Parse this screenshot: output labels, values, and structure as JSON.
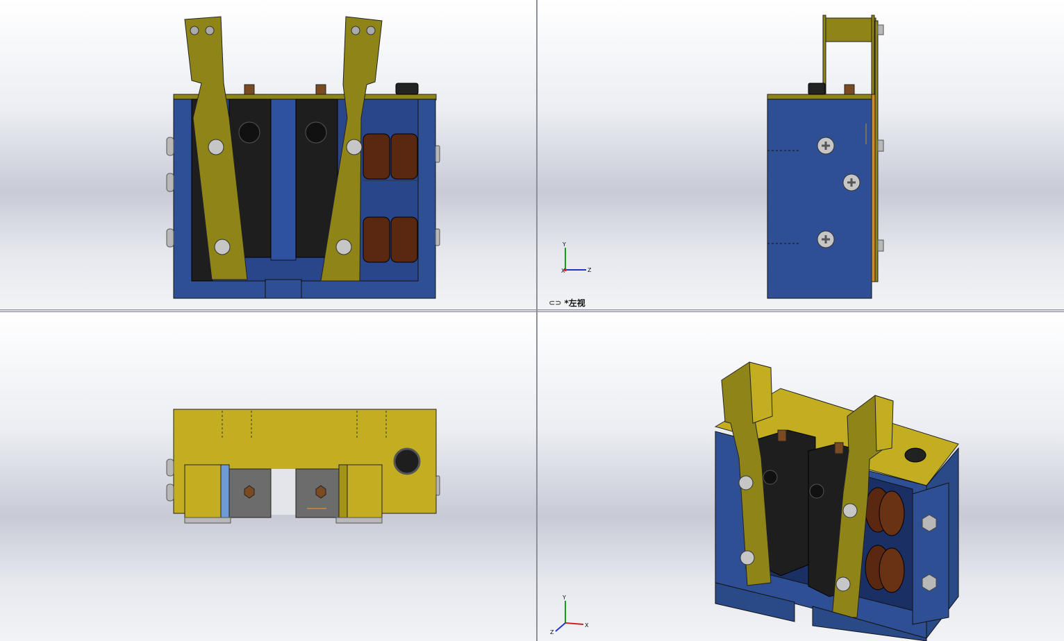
{
  "viewports": {
    "top_left": {
      "name": "front-view"
    },
    "top_right": {
      "name": "left-view",
      "label": "*左视",
      "link_icon": "link-icon"
    },
    "bottom_left": {
      "name": "top-view"
    },
    "bottom_right": {
      "name": "isometric-view"
    }
  },
  "triad": {
    "x": "X",
    "y": "Y",
    "z": "Z"
  },
  "colors": {
    "housing_blue": "#2e4f93",
    "bracket_yellow": "#8f8418",
    "plate_yellow": "#c2ae20",
    "block_black": "#1e1e1e",
    "roller_brown": "#5a2810",
    "bolt_grey": "#b8b8b8"
  }
}
